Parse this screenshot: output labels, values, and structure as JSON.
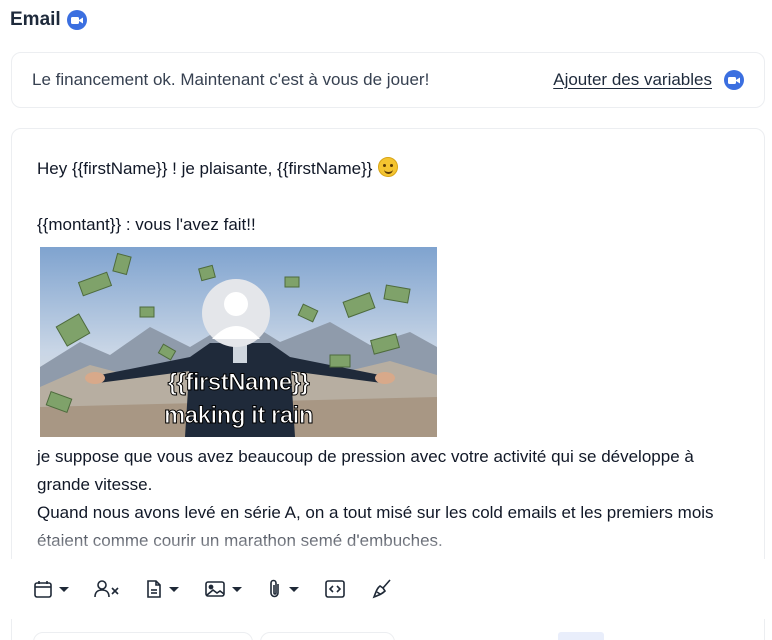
{
  "header": {
    "title": "Email",
    "icon": "video-camera-icon",
    "accent": "#3b6fe0"
  },
  "subject": {
    "text": "Le financement ok. Maintenant c'est à vous de jouer!",
    "add_variables_label": "Ajouter des variables",
    "video_icon": "video-camera-icon"
  },
  "body": {
    "line1": "Hey {{firstName}} ! je plaisante, {{firstName}}",
    "line1_emoji": "winking-face-icon",
    "line2": "{{montant}} : vous l'avez fait!!",
    "gif": {
      "caption_line1": "{{firstName}}",
      "caption_line2": "making it rain"
    },
    "para1": "je suppose que vous avez beaucoup de pression avec votre activité qui se développe à grande vitesse.",
    "para2": "Quand nous avons levé en série A, on a tout misé sur les cold emails et les premiers mois étaient comme courir un marathon semé d'embuches."
  },
  "toolbar": {
    "items": [
      {
        "icon": "calendar-icon",
        "has_dropdown": true
      },
      {
        "icon": "remove-user-variable-icon",
        "has_dropdown": false
      },
      {
        "icon": "document-template-icon",
        "has_dropdown": true
      },
      {
        "icon": "image-icon",
        "has_dropdown": true
      },
      {
        "icon": "paperclip-icon",
        "has_dropdown": true
      },
      {
        "icon": "code-icon",
        "has_dropdown": false
      },
      {
        "icon": "clean-format-brush-icon",
        "has_dropdown": false
      }
    ]
  }
}
